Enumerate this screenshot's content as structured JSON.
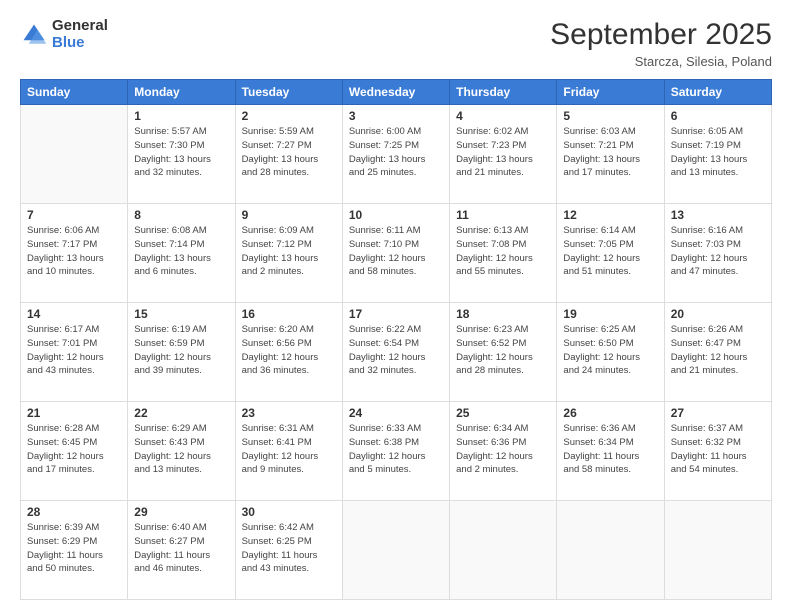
{
  "header": {
    "logo_general": "General",
    "logo_blue": "Blue",
    "month": "September 2025",
    "location": "Starcza, Silesia, Poland"
  },
  "days_of_week": [
    "Sunday",
    "Monday",
    "Tuesday",
    "Wednesday",
    "Thursday",
    "Friday",
    "Saturday"
  ],
  "weeks": [
    [
      {
        "num": "",
        "detail": ""
      },
      {
        "num": "1",
        "detail": "Sunrise: 5:57 AM\nSunset: 7:30 PM\nDaylight: 13 hours\nand 32 minutes."
      },
      {
        "num": "2",
        "detail": "Sunrise: 5:59 AM\nSunset: 7:27 PM\nDaylight: 13 hours\nand 28 minutes."
      },
      {
        "num": "3",
        "detail": "Sunrise: 6:00 AM\nSunset: 7:25 PM\nDaylight: 13 hours\nand 25 minutes."
      },
      {
        "num": "4",
        "detail": "Sunrise: 6:02 AM\nSunset: 7:23 PM\nDaylight: 13 hours\nand 21 minutes."
      },
      {
        "num": "5",
        "detail": "Sunrise: 6:03 AM\nSunset: 7:21 PM\nDaylight: 13 hours\nand 17 minutes."
      },
      {
        "num": "6",
        "detail": "Sunrise: 6:05 AM\nSunset: 7:19 PM\nDaylight: 13 hours\nand 13 minutes."
      }
    ],
    [
      {
        "num": "7",
        "detail": "Sunrise: 6:06 AM\nSunset: 7:17 PM\nDaylight: 13 hours\nand 10 minutes."
      },
      {
        "num": "8",
        "detail": "Sunrise: 6:08 AM\nSunset: 7:14 PM\nDaylight: 13 hours\nand 6 minutes."
      },
      {
        "num": "9",
        "detail": "Sunrise: 6:09 AM\nSunset: 7:12 PM\nDaylight: 13 hours\nand 2 minutes."
      },
      {
        "num": "10",
        "detail": "Sunrise: 6:11 AM\nSunset: 7:10 PM\nDaylight: 12 hours\nand 58 minutes."
      },
      {
        "num": "11",
        "detail": "Sunrise: 6:13 AM\nSunset: 7:08 PM\nDaylight: 12 hours\nand 55 minutes."
      },
      {
        "num": "12",
        "detail": "Sunrise: 6:14 AM\nSunset: 7:05 PM\nDaylight: 12 hours\nand 51 minutes."
      },
      {
        "num": "13",
        "detail": "Sunrise: 6:16 AM\nSunset: 7:03 PM\nDaylight: 12 hours\nand 47 minutes."
      }
    ],
    [
      {
        "num": "14",
        "detail": "Sunrise: 6:17 AM\nSunset: 7:01 PM\nDaylight: 12 hours\nand 43 minutes."
      },
      {
        "num": "15",
        "detail": "Sunrise: 6:19 AM\nSunset: 6:59 PM\nDaylight: 12 hours\nand 39 minutes."
      },
      {
        "num": "16",
        "detail": "Sunrise: 6:20 AM\nSunset: 6:56 PM\nDaylight: 12 hours\nand 36 minutes."
      },
      {
        "num": "17",
        "detail": "Sunrise: 6:22 AM\nSunset: 6:54 PM\nDaylight: 12 hours\nand 32 minutes."
      },
      {
        "num": "18",
        "detail": "Sunrise: 6:23 AM\nSunset: 6:52 PM\nDaylight: 12 hours\nand 28 minutes."
      },
      {
        "num": "19",
        "detail": "Sunrise: 6:25 AM\nSunset: 6:50 PM\nDaylight: 12 hours\nand 24 minutes."
      },
      {
        "num": "20",
        "detail": "Sunrise: 6:26 AM\nSunset: 6:47 PM\nDaylight: 12 hours\nand 21 minutes."
      }
    ],
    [
      {
        "num": "21",
        "detail": "Sunrise: 6:28 AM\nSunset: 6:45 PM\nDaylight: 12 hours\nand 17 minutes."
      },
      {
        "num": "22",
        "detail": "Sunrise: 6:29 AM\nSunset: 6:43 PM\nDaylight: 12 hours\nand 13 minutes."
      },
      {
        "num": "23",
        "detail": "Sunrise: 6:31 AM\nSunset: 6:41 PM\nDaylight: 12 hours\nand 9 minutes."
      },
      {
        "num": "24",
        "detail": "Sunrise: 6:33 AM\nSunset: 6:38 PM\nDaylight: 12 hours\nand 5 minutes."
      },
      {
        "num": "25",
        "detail": "Sunrise: 6:34 AM\nSunset: 6:36 PM\nDaylight: 12 hours\nand 2 minutes."
      },
      {
        "num": "26",
        "detail": "Sunrise: 6:36 AM\nSunset: 6:34 PM\nDaylight: 11 hours\nand 58 minutes."
      },
      {
        "num": "27",
        "detail": "Sunrise: 6:37 AM\nSunset: 6:32 PM\nDaylight: 11 hours\nand 54 minutes."
      }
    ],
    [
      {
        "num": "28",
        "detail": "Sunrise: 6:39 AM\nSunset: 6:29 PM\nDaylight: 11 hours\nand 50 minutes."
      },
      {
        "num": "29",
        "detail": "Sunrise: 6:40 AM\nSunset: 6:27 PM\nDaylight: 11 hours\nand 46 minutes."
      },
      {
        "num": "30",
        "detail": "Sunrise: 6:42 AM\nSunset: 6:25 PM\nDaylight: 11 hours\nand 43 minutes."
      },
      {
        "num": "",
        "detail": ""
      },
      {
        "num": "",
        "detail": ""
      },
      {
        "num": "",
        "detail": ""
      },
      {
        "num": "",
        "detail": ""
      }
    ]
  ]
}
